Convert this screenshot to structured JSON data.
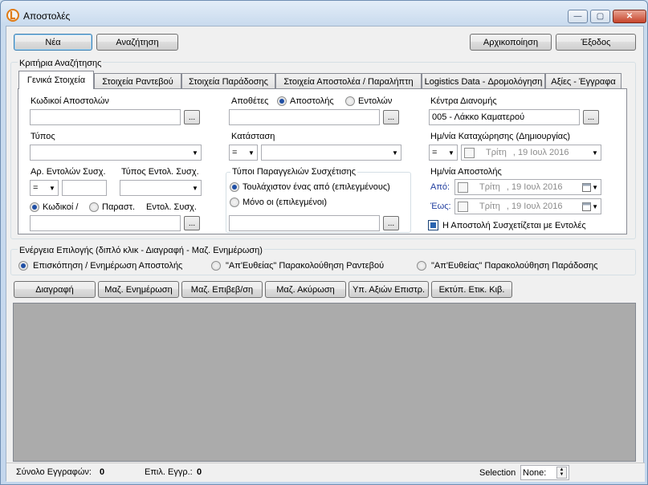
{
  "window": {
    "title": "Αποστολές",
    "app_icon": "app-logo-icon",
    "min_symbol": "—",
    "max_symbol": "▢",
    "close_symbol": "✕"
  },
  "toolbar": {
    "new_label": "Νέα",
    "search_label": "Αναζήτηση",
    "reset_label": "Αρχικοποίηση",
    "exit_label": "Έξοδος"
  },
  "criteria": {
    "group_title": "Κριτήρια Αναζήτησης",
    "tabs": [
      {
        "label": "Γενικά Στοιχεία",
        "active": true
      },
      {
        "label": "Στοιχεία Ραντεβού"
      },
      {
        "label": "Στοιχεία Παράδοσης"
      },
      {
        "label": "Στοιχεία Αποστολέα / Παραλήπτη"
      },
      {
        "label": "Logistics Data - Δρομολόγηση"
      },
      {
        "label": "Αξίες - Έγγραφα"
      }
    ],
    "shipment_codes_label": "Κωδικοί Αποστολών",
    "type_label": "Τύπος",
    "order_count_label": "Αρ. Εντολών Συσχ.",
    "order_count_op": "=",
    "order_type_label": "Τύπος Εντολ. Συσχ.",
    "codes_radio_label": "Κωδικοί /",
    "docs_radio_label": "Παραστ.",
    "order_rel_label": "Εντολ. Συσχ.",
    "warehouses_label": "Αποθέτες",
    "warehouses_opt_shipment": "Αποστολής",
    "warehouses_opt_order": "Εντολών",
    "status_label": "Κατάσταση",
    "status_op": "=",
    "order_types_group_title": "Τύποι Παραγγελιών Συσχέτισης",
    "order_types_opt_any": "Τουλάχιστον ένας από (επιλεγμένους)",
    "order_types_opt_only": "Μόνο οι (επιλεγμένοι)",
    "distribution_center_label": "Κέντρα Διανομής",
    "distribution_center_value": "005 - Λάκκο Καματερού",
    "reg_date_label": "Ημ/νία Καταχώρησης (Δημιουργίας)",
    "reg_date_op": "=",
    "reg_date_day": "Τρίτη",
    "reg_date_date": ", 19 Ιουλ  2016",
    "ship_date_label": "Ημ/νία Αποστολής",
    "from_label": "Από:",
    "from_day": "Τρίτη",
    "from_date": ", 19 Ιουλ  2016",
    "to_label": "Έως:",
    "to_day": "Τρίτη",
    "to_date": ", 19 Ιουλ  2016",
    "linked_orders_label": "Η Αποστολή Συσχετίζεται με Εντολές",
    "ellipsis": "..."
  },
  "action": {
    "group_title": "Ενέργεια Επιλογής (διπλό κλικ - Διαγραφή - Μαζ. Ενημέρωση)",
    "options": [
      {
        "label": "Επισκόπηση / Ενημέρωση Αποστολής",
        "selected": true
      },
      {
        "label": "\"Απ'Ευθείας\" Παρακολούθηση Ραντεβού",
        "selected": false
      },
      {
        "label": "\"Απ'Ευθείας\" Παρακολούθηση Παράδοσης",
        "selected": false
      }
    ]
  },
  "bulk_buttons": [
    "Διαγραφή",
    "Μαζ. Ενημέρωση",
    "Μαζ. Επιβεβ/ση",
    "Μαζ. Ακύρωση",
    "Υπ. Αξιών Επιστρ.",
    "Εκτύπ. Ετικ. Κιβ."
  ],
  "status": {
    "total_label": "Σύνολο Εγγραφών:",
    "total_value": "0",
    "selected_label": "Επιλ. Εγγρ.:",
    "selected_value": "0",
    "selection_label": "Selection",
    "selection_value": "None:"
  },
  "colors": {
    "grid_bg": "#ababab",
    "panel_bg": "#f0f0f0",
    "accent": "#1f4fa5"
  }
}
